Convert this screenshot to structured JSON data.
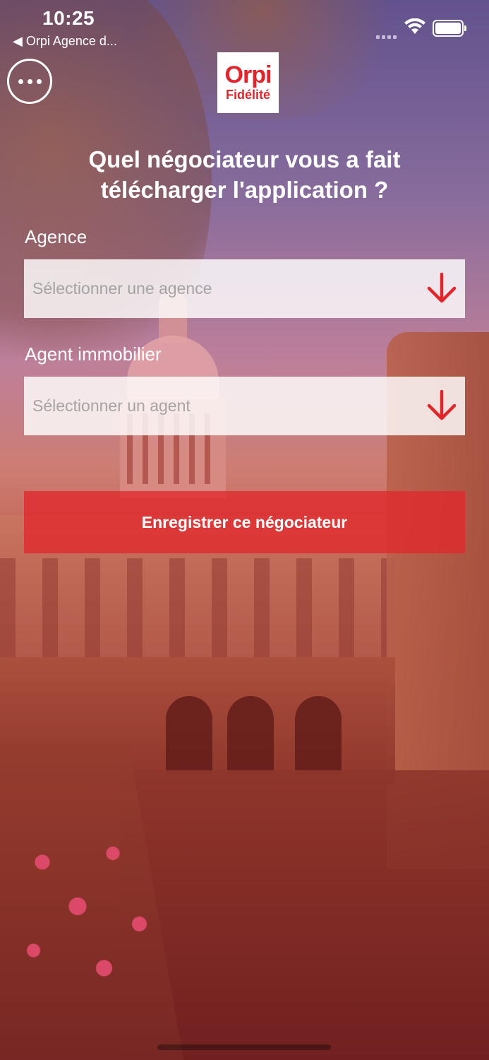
{
  "status_bar": {
    "time": "10:25",
    "back_label": "◀ Orpi Agence d..."
  },
  "logo": {
    "brand": "Orpi",
    "tagline": "Fidélité",
    "brand_color": "#e3242b"
  },
  "page_title": "Quel négociateur vous a fait télécharger l'application ?",
  "form": {
    "agency": {
      "label": "Agence",
      "placeholder": "Sélectionner une agence"
    },
    "agent": {
      "label": "Agent immobilier",
      "placeholder": "Sélectionner un agent"
    },
    "submit_label": "Enregistrer ce négociateur"
  },
  "icons": {
    "menu": "more-horizontal-icon",
    "dropdown": "arrow-down-icon"
  },
  "colors": {
    "accent": "#e3242b",
    "overlay": "#c82828"
  }
}
